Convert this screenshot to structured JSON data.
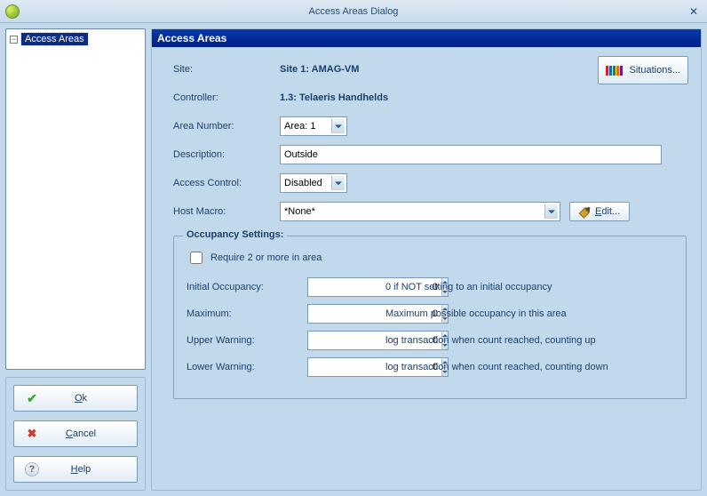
{
  "window": {
    "title": "Access Areas Dialog"
  },
  "tree": {
    "root_label": "Access Areas"
  },
  "buttons": {
    "ok": "Ok",
    "cancel": "Cancel",
    "help": "Help"
  },
  "section": {
    "title": "Access Areas"
  },
  "form": {
    "site_label": "Site:",
    "site_value": "Site 1: AMAG-VM",
    "controller_label": "Controller:",
    "controller_value": "1.3: Telaeris Handhelds",
    "area_number_label": "Area Number:",
    "area_number_value": "Area: 1",
    "description_label": "Description:",
    "description_value": "Outside",
    "access_control_label": "Access Control:",
    "access_control_value": "Disabled",
    "host_macro_label": "Host Macro:",
    "host_macro_value": "*None*",
    "edit_label": "Edit...",
    "situations_label": "Situations..."
  },
  "occupancy": {
    "legend": "Occupancy Settings:",
    "require2_label": "Require 2 or more in area",
    "require2_checked": false,
    "rows": [
      {
        "label": "Initial Occupancy:",
        "value": "0",
        "desc": "0 if NOT setting to an initial occupancy"
      },
      {
        "label": "Maximum:",
        "value": "0",
        "desc": "Maximum possible occupancy in this area"
      },
      {
        "label": "Upper Warning:",
        "value": "0",
        "desc": "log transaction when count reached, counting up"
      },
      {
        "label": "Lower Warning:",
        "value": "0",
        "desc": "log transaction when count reached, counting down"
      }
    ]
  }
}
